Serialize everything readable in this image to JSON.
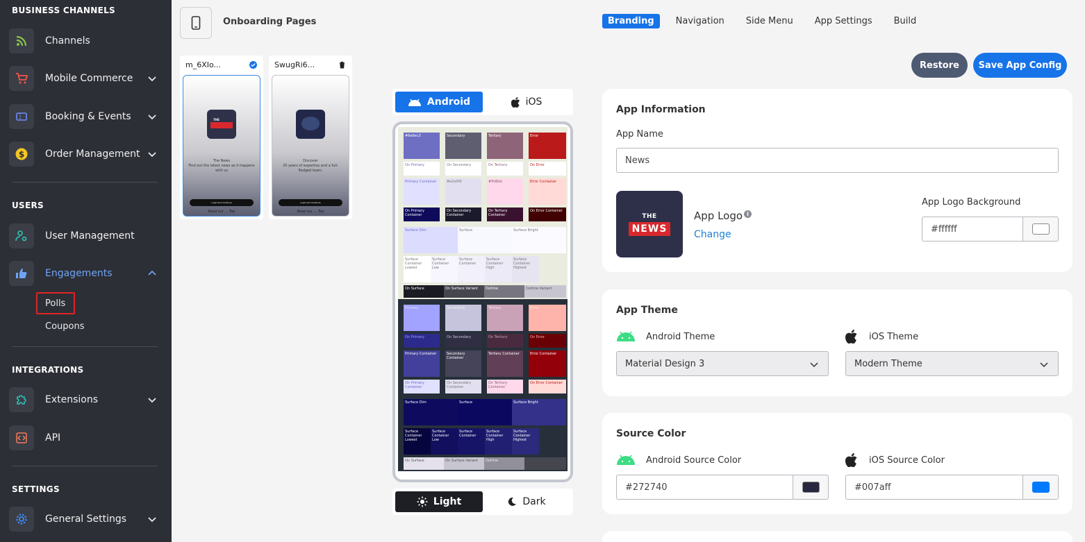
{
  "sidebar": {
    "sections": {
      "business": "BUSINESS CHANNELS",
      "users": "USERS",
      "integrations": "INTEGRATIONS",
      "settings": "SETTINGS"
    },
    "items": {
      "channels": "Channels",
      "mobile_commerce": "Mobile Commerce",
      "booking_events": "Booking & Events",
      "order_management": "Order Management",
      "user_management": "User Management",
      "engagements": "Engagements",
      "polls": "Polls",
      "coupons": "Coupons",
      "extensions": "Extensions",
      "api": "API",
      "general_settings": "General Settings"
    }
  },
  "header": {
    "onboarding_title": "Onboarding Pages",
    "tabs": [
      "Branding",
      "Navigation",
      "Side Menu",
      "App Settings",
      "Build"
    ],
    "restore_label": "Restore",
    "save_label": "Save App Config"
  },
  "onboarding_cards": [
    {
      "name": "m_6XIo...",
      "title": "The News",
      "body": "Find out the latest news as it happens with us",
      "button": "Login and Continue",
      "footer": "Read our ... Tap"
    },
    {
      "name": "SwugRi6...",
      "title": "Discover",
      "body": "20 years of expertise and a full-fledged team.",
      "button": "Login and Continue",
      "footer": "Read our ... Tap"
    }
  ],
  "platform_toggle": {
    "android": "Android",
    "ios": "iOS"
  },
  "mode_toggle": {
    "light": "Light",
    "dark": "Dark"
  },
  "preview": {
    "light_row1": [
      "#6e6ec3",
      "Secondary",
      "Tertiary",
      "Error"
    ],
    "light_row2": [
      "On Primary",
      "On Secondary",
      "On Tertiary",
      "On Error"
    ],
    "light_row3": [
      "Primary Container",
      "#e2e0f0",
      "#ffd8eb",
      "Error Container"
    ],
    "light_row4": [
      "On Primary Container",
      "On Secondary Container",
      "On Tertiary Container",
      "On Error Container"
    ],
    "light_surface": [
      "Surface Dim",
      "Surface",
      "Surface Bright"
    ],
    "light_surface_containers": [
      "Surface Container Lowest",
      "Surface Container Low",
      "Surface Container",
      "Surface Container High",
      "Surface Container Highest"
    ],
    "light_on": [
      "On Surface",
      "On Surface Variant",
      "Outline",
      "Outline Variant"
    ],
    "dark_row1": [
      "Primary",
      "Secondary",
      "Tertiary",
      "Error"
    ],
    "dark_row2": [
      "On Primary",
      "On Secondary",
      "On Tertiary",
      "On Error"
    ],
    "dark_row3": [
      "Primary Container",
      "Secondary Container",
      "Tertiary Container",
      "Error Container"
    ],
    "dark_row4": [
      "On Primary Container",
      "On Secondary Container",
      "On Tertiary Container",
      "On Error Container"
    ],
    "dark_surface": [
      "Surface Dim",
      "Surface",
      "Surface Bright"
    ],
    "dark_surface_containers": [
      "Surface Container Lowest",
      "Surface Container Low",
      "Surface Container",
      "Surface Container High",
      "Surface Container Highest"
    ],
    "dark_on": [
      "On Surface",
      "On Surface Variant",
      "Outline"
    ]
  },
  "app_info": {
    "title": "App Information",
    "app_name_label": "App Name",
    "app_name_value": "News",
    "logo_label": "App Logo",
    "logo_the": "THE",
    "logo_news": "NEWS",
    "change_label": "Change",
    "logo_bg_label": "App Logo Background",
    "logo_bg_value": "#ffffff"
  },
  "app_theme": {
    "title": "App Theme",
    "android_label": "Android Theme",
    "android_value": "Material Design 3",
    "ios_label": "iOS Theme",
    "ios_value": "Modern Theme"
  },
  "source_color": {
    "title": "Source Color",
    "android_label": "Android Source Color",
    "android_value": "#272740",
    "ios_label": "iOS Source Color",
    "ios_value": "#007aff"
  },
  "colors": {
    "sidebar_bg": "#2d2f36",
    "accent": "#1773e8",
    "restore": "#4e5a72",
    "polls_highlight": "#e02424"
  }
}
